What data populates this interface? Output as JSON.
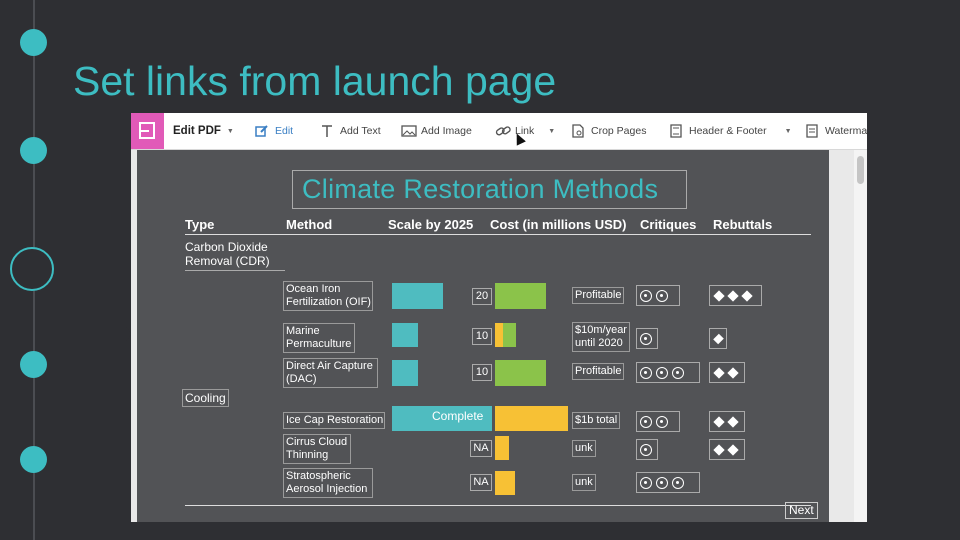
{
  "slide": {
    "title": "Set links from launch page"
  },
  "toolbar": {
    "edit_pdf": "Edit PDF",
    "edit": "Edit",
    "add_text": "Add Text",
    "add_image": "Add Image",
    "link": "Link",
    "crop_pages": "Crop Pages",
    "header_footer": "Header & Footer",
    "watermark": "Watermar"
  },
  "doc": {
    "title": "Climate Restoration Methods",
    "headers": {
      "type": "Type",
      "method": "Method",
      "scale": "Scale by 2025",
      "cost": "Cost (in millions USD)",
      "critiques": "Critiques",
      "rebuttals": "Rebuttals"
    },
    "types": {
      "cdr_line1": "Carbon Dioxide",
      "cdr_line2": "Removal (CDR)",
      "cooling": "Cooling"
    },
    "rows": [
      {
        "method_l1": "Ocean Iron",
        "method_l2": "Fertilization (OIF)",
        "scale": "20",
        "cost": "Profitable",
        "cost_l2": "",
        "critiques": 2,
        "rebuttals": 3
      },
      {
        "method_l1": "Marine",
        "method_l2": "Permaculture",
        "scale": "10",
        "cost": "$10m/year",
        "cost_l2": "until 2020",
        "critiques": 1,
        "rebuttals": 1
      },
      {
        "method_l1": "Direct Air Capture",
        "method_l2": "(DAC)",
        "scale": "10",
        "cost": "Profitable",
        "cost_l2": "",
        "critiques": 3,
        "rebuttals": 2
      },
      {
        "method_l1": "Ice Cap Restoration",
        "method_l2": "",
        "scale": "Complete",
        "cost": "$1b total",
        "cost_l2": "",
        "critiques": 2,
        "rebuttals": 2
      },
      {
        "method_l1": "Cirrus Cloud",
        "method_l2": "Thinning",
        "scale": "NA",
        "cost": "unk",
        "cost_l2": "",
        "critiques": 1,
        "rebuttals": 2
      },
      {
        "method_l1": "Stratospheric",
        "method_l2": "Aerosol Injection",
        "scale": "NA",
        "cost": "unk",
        "cost_l2": "",
        "critiques": 3,
        "rebuttals": 0
      }
    ],
    "next": "Next"
  },
  "colors": {
    "accent": "#3dbdc2",
    "teal_bar": "#4fbcc0",
    "green_bar": "#8bc34a",
    "yellow_bar": "#f7c135",
    "logo": "#e15ab8"
  },
  "icons": [
    "edit-pdf-icon",
    "edit-icon",
    "text-icon",
    "image-icon",
    "link-icon",
    "crop-icon",
    "header-footer-icon",
    "watermark-icon"
  ]
}
